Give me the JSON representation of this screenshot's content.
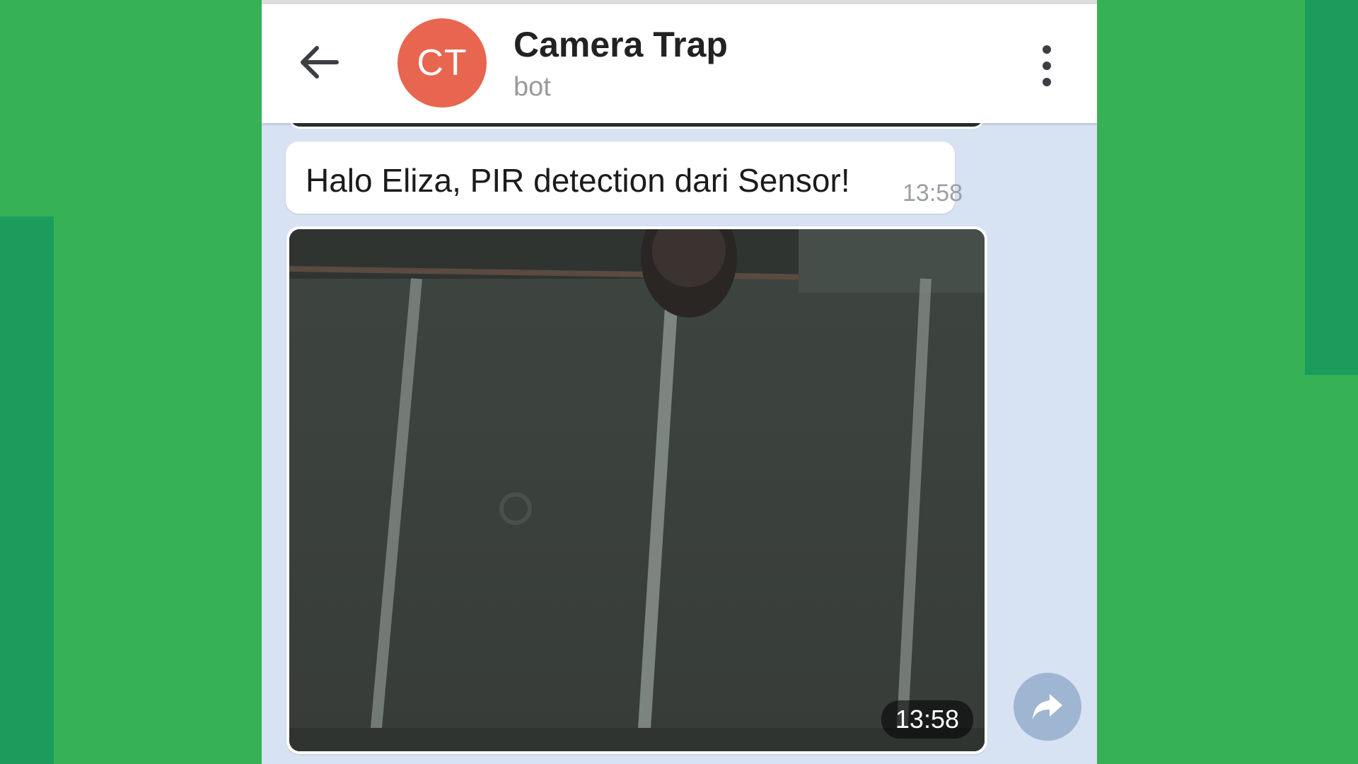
{
  "colors": {
    "background": "#36b155",
    "decor": "#1c9c5c",
    "chat_background": "#d7e2f3",
    "avatar": "#e8654f",
    "share_button": "#9fb6d2"
  },
  "header": {
    "back_icon": "arrow-left-icon",
    "avatar_initials": "CT",
    "title": "Camera Trap",
    "subtitle": "bot",
    "menu_icon": "more-vertical-icon"
  },
  "messages": [
    {
      "type": "text",
      "text": "Halo Eliza, PIR detection dari Sensor!",
      "time": "13:58"
    },
    {
      "type": "photo",
      "time": "13:58",
      "share_icon": "share-arrow-icon"
    }
  ]
}
